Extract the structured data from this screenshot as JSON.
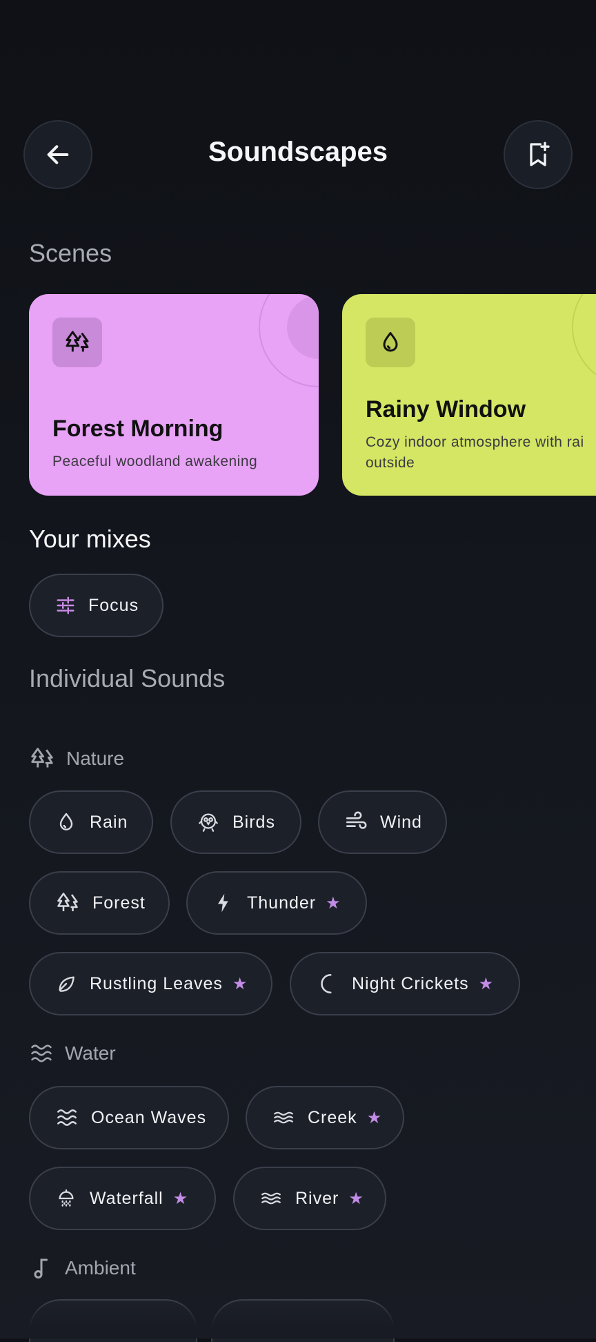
{
  "header": {
    "title": "Soundscapes",
    "back_icon": "arrow-left-icon",
    "bookmark_icon": "bookmark-add-icon"
  },
  "scenes": {
    "heading": "Scenes",
    "cards": [
      {
        "title": "Forest Morning",
        "subtitle": "Peaceful woodland awakening",
        "icon": "forest-icon",
        "color": "#e7a3f7"
      },
      {
        "title": "Rainy Window",
        "subtitle_line1": "Cozy indoor atmosphere with rai",
        "subtitle_line2": "outside",
        "icon": "water-drop-icon",
        "color": "#d4e563"
      }
    ]
  },
  "mixes": {
    "heading": "Your mixes",
    "items": [
      {
        "label": "Focus",
        "icon": "sliders-icon"
      }
    ]
  },
  "sounds": {
    "heading": "Individual Sounds",
    "categories": [
      {
        "label": "Nature",
        "icon": "forest-icon",
        "chips": [
          {
            "label": "Rain",
            "icon": "water-drop-icon",
            "starred": false
          },
          {
            "label": "Birds",
            "icon": "bird-icon",
            "starred": false
          },
          {
            "label": "Wind",
            "icon": "wind-icon",
            "starred": false
          },
          {
            "label": "Forest",
            "icon": "forest-icon",
            "starred": false
          },
          {
            "label": "Thunder",
            "icon": "lightning-icon",
            "starred": true
          },
          {
            "label": "Rustling Leaves",
            "icon": "leaf-icon",
            "starred": true
          },
          {
            "label": "Night Crickets",
            "icon": "moon-icon",
            "starred": true
          }
        ]
      },
      {
        "label": "Water",
        "icon": "waves-icon",
        "chips": [
          {
            "label": "Ocean Waves",
            "icon": "waves-icon",
            "starred": false
          },
          {
            "label": "Creek",
            "icon": "waves-icon",
            "starred": true
          },
          {
            "label": "Waterfall",
            "icon": "shower-icon",
            "starred": true
          },
          {
            "label": "River",
            "icon": "waves-icon",
            "starred": true
          }
        ]
      },
      {
        "label": "Ambient",
        "icon": "music-note-icon",
        "chips": []
      }
    ]
  },
  "star_glyph": "★",
  "colors": {
    "accent": "#c38ce6",
    "background": "#101217",
    "chip_border": "#3a3f4b"
  }
}
